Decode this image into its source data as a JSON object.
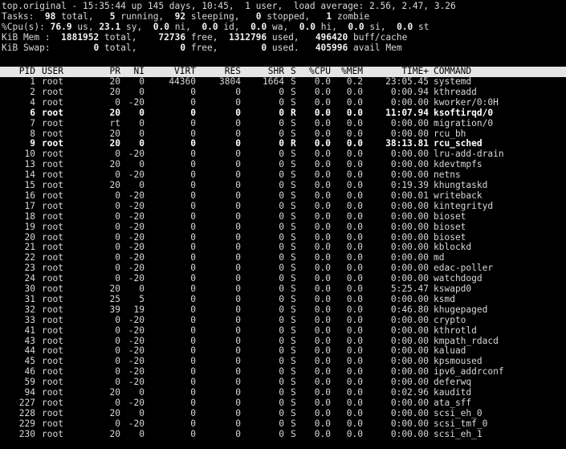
{
  "header": {
    "line1": "top.original - 15:35:44 up 145 days, 10:45,  1 user,  load average: 2.56, 2.47, 3.26",
    "tasks": {
      "label": "Tasks:",
      "total": "98",
      "total_label": "total,",
      "running": "5",
      "running_label": "running,",
      "sleeping": "92",
      "sleeping_label": "sleeping,",
      "stopped": "0",
      "stopped_label": "stopped,",
      "zombie": "1",
      "zombie_label": "zombie"
    },
    "cpu": {
      "label": "%Cpu(s):",
      "us": "76.9",
      "us_label": "us,",
      "sy": "23.1",
      "sy_label": "sy,",
      "ni": "0.0",
      "ni_label": "ni,",
      "id": "0.0",
      "id_label": "id,",
      "wa": "0.0",
      "wa_label": "wa,",
      "hi": "0.0",
      "hi_label": "hi,",
      "si": "0.0",
      "si_label": "si,",
      "st": "0.0",
      "st_label": "st"
    },
    "mem": {
      "label": "KiB Mem :",
      "total": "1881952",
      "total_label": "total,",
      "free": "72736",
      "free_label": "free,",
      "used": "1312796",
      "used_label": "used,",
      "buff": "496420",
      "buff_label": "buff/cache"
    },
    "swap": {
      "label": "KiB Swap:",
      "total": "0",
      "total_label": "total,",
      "free": "0",
      "free_label": "free,",
      "used": "0",
      "used_label": "used.",
      "avail": "405996",
      "avail_label": "avail Mem"
    }
  },
  "columns": {
    "pid": "PID",
    "user": "USER",
    "pr": "PR",
    "ni": "NI",
    "virt": "VIRT",
    "res": "RES",
    "shr": "SHR",
    "s": "S",
    "cpu": "%CPU",
    "mem": "%MEM",
    "time": "TIME+",
    "command": "COMMAND"
  },
  "processes": [
    {
      "pid": "1",
      "user": "root",
      "pr": "20",
      "ni": "0",
      "virt": "44360",
      "res": "3804",
      "shr": "1664",
      "s": "S",
      "cpu": "0.0",
      "mem": "0.2",
      "time": "23:05.45",
      "command": "systemd",
      "running": false
    },
    {
      "pid": "2",
      "user": "root",
      "pr": "20",
      "ni": "0",
      "virt": "0",
      "res": "0",
      "shr": "0",
      "s": "S",
      "cpu": "0.0",
      "mem": "0.0",
      "time": "0:00.94",
      "command": "kthreadd",
      "running": false
    },
    {
      "pid": "4",
      "user": "root",
      "pr": "0",
      "ni": "-20",
      "virt": "0",
      "res": "0",
      "shr": "0",
      "s": "S",
      "cpu": "0.0",
      "mem": "0.0",
      "time": "0:00.00",
      "command": "kworker/0:0H",
      "running": false
    },
    {
      "pid": "6",
      "user": "root",
      "pr": "20",
      "ni": "0",
      "virt": "0",
      "res": "0",
      "shr": "0",
      "s": "R",
      "cpu": "0.0",
      "mem": "0.0",
      "time": "11:07.94",
      "command": "ksoftirqd/0",
      "running": true
    },
    {
      "pid": "7",
      "user": "root",
      "pr": "rt",
      "ni": "0",
      "virt": "0",
      "res": "0",
      "shr": "0",
      "s": "S",
      "cpu": "0.0",
      "mem": "0.0",
      "time": "0:00.00",
      "command": "migration/0",
      "running": false
    },
    {
      "pid": "8",
      "user": "root",
      "pr": "20",
      "ni": "0",
      "virt": "0",
      "res": "0",
      "shr": "0",
      "s": "S",
      "cpu": "0.0",
      "mem": "0.0",
      "time": "0:00.00",
      "command": "rcu_bh",
      "running": false
    },
    {
      "pid": "9",
      "user": "root",
      "pr": "20",
      "ni": "0",
      "virt": "0",
      "res": "0",
      "shr": "0",
      "s": "R",
      "cpu": "0.0",
      "mem": "0.0",
      "time": "38:13.81",
      "command": "rcu_sched",
      "running": true
    },
    {
      "pid": "10",
      "user": "root",
      "pr": "0",
      "ni": "-20",
      "virt": "0",
      "res": "0",
      "shr": "0",
      "s": "S",
      "cpu": "0.0",
      "mem": "0.0",
      "time": "0:00.00",
      "command": "lru-add-drain",
      "running": false
    },
    {
      "pid": "13",
      "user": "root",
      "pr": "20",
      "ni": "0",
      "virt": "0",
      "res": "0",
      "shr": "0",
      "s": "S",
      "cpu": "0.0",
      "mem": "0.0",
      "time": "0:00.00",
      "command": "kdevtmpfs",
      "running": false
    },
    {
      "pid": "14",
      "user": "root",
      "pr": "0",
      "ni": "-20",
      "virt": "0",
      "res": "0",
      "shr": "0",
      "s": "S",
      "cpu": "0.0",
      "mem": "0.0",
      "time": "0:00.00",
      "command": "netns",
      "running": false
    },
    {
      "pid": "15",
      "user": "root",
      "pr": "20",
      "ni": "0",
      "virt": "0",
      "res": "0",
      "shr": "0",
      "s": "S",
      "cpu": "0.0",
      "mem": "0.0",
      "time": "0:19.39",
      "command": "khungtaskd",
      "running": false
    },
    {
      "pid": "16",
      "user": "root",
      "pr": "0",
      "ni": "-20",
      "virt": "0",
      "res": "0",
      "shr": "0",
      "s": "S",
      "cpu": "0.0",
      "mem": "0.0",
      "time": "0:00.01",
      "command": "writeback",
      "running": false
    },
    {
      "pid": "17",
      "user": "root",
      "pr": "0",
      "ni": "-20",
      "virt": "0",
      "res": "0",
      "shr": "0",
      "s": "S",
      "cpu": "0.0",
      "mem": "0.0",
      "time": "0:00.00",
      "command": "kintegrityd",
      "running": false
    },
    {
      "pid": "18",
      "user": "root",
      "pr": "0",
      "ni": "-20",
      "virt": "0",
      "res": "0",
      "shr": "0",
      "s": "S",
      "cpu": "0.0",
      "mem": "0.0",
      "time": "0:00.00",
      "command": "bioset",
      "running": false
    },
    {
      "pid": "19",
      "user": "root",
      "pr": "0",
      "ni": "-20",
      "virt": "0",
      "res": "0",
      "shr": "0",
      "s": "S",
      "cpu": "0.0",
      "mem": "0.0",
      "time": "0:00.00",
      "command": "bioset",
      "running": false
    },
    {
      "pid": "20",
      "user": "root",
      "pr": "0",
      "ni": "-20",
      "virt": "0",
      "res": "0",
      "shr": "0",
      "s": "S",
      "cpu": "0.0",
      "mem": "0.0",
      "time": "0:00.00",
      "command": "bioset",
      "running": false
    },
    {
      "pid": "21",
      "user": "root",
      "pr": "0",
      "ni": "-20",
      "virt": "0",
      "res": "0",
      "shr": "0",
      "s": "S",
      "cpu": "0.0",
      "mem": "0.0",
      "time": "0:00.00",
      "command": "kblockd",
      "running": false
    },
    {
      "pid": "22",
      "user": "root",
      "pr": "0",
      "ni": "-20",
      "virt": "0",
      "res": "0",
      "shr": "0",
      "s": "S",
      "cpu": "0.0",
      "mem": "0.0",
      "time": "0:00.00",
      "command": "md",
      "running": false
    },
    {
      "pid": "23",
      "user": "root",
      "pr": "0",
      "ni": "-20",
      "virt": "0",
      "res": "0",
      "shr": "0",
      "s": "S",
      "cpu": "0.0",
      "mem": "0.0",
      "time": "0:00.00",
      "command": "edac-poller",
      "running": false
    },
    {
      "pid": "24",
      "user": "root",
      "pr": "0",
      "ni": "-20",
      "virt": "0",
      "res": "0",
      "shr": "0",
      "s": "S",
      "cpu": "0.0",
      "mem": "0.0",
      "time": "0:00.00",
      "command": "watchdogd",
      "running": false
    },
    {
      "pid": "30",
      "user": "root",
      "pr": "20",
      "ni": "0",
      "virt": "0",
      "res": "0",
      "shr": "0",
      "s": "S",
      "cpu": "0.0",
      "mem": "0.0",
      "time": "5:25.47",
      "command": "kswapd0",
      "running": false
    },
    {
      "pid": "31",
      "user": "root",
      "pr": "25",
      "ni": "5",
      "virt": "0",
      "res": "0",
      "shr": "0",
      "s": "S",
      "cpu": "0.0",
      "mem": "0.0",
      "time": "0:00.00",
      "command": "ksmd",
      "running": false
    },
    {
      "pid": "32",
      "user": "root",
      "pr": "39",
      "ni": "19",
      "virt": "0",
      "res": "0",
      "shr": "0",
      "s": "S",
      "cpu": "0.0",
      "mem": "0.0",
      "time": "0:46.80",
      "command": "khugepaged",
      "running": false
    },
    {
      "pid": "33",
      "user": "root",
      "pr": "0",
      "ni": "-20",
      "virt": "0",
      "res": "0",
      "shr": "0",
      "s": "S",
      "cpu": "0.0",
      "mem": "0.0",
      "time": "0:00.00",
      "command": "crypto",
      "running": false
    },
    {
      "pid": "41",
      "user": "root",
      "pr": "0",
      "ni": "-20",
      "virt": "0",
      "res": "0",
      "shr": "0",
      "s": "S",
      "cpu": "0.0",
      "mem": "0.0",
      "time": "0:00.00",
      "command": "kthrotld",
      "running": false
    },
    {
      "pid": "43",
      "user": "root",
      "pr": "0",
      "ni": "-20",
      "virt": "0",
      "res": "0",
      "shr": "0",
      "s": "S",
      "cpu": "0.0",
      "mem": "0.0",
      "time": "0:00.00",
      "command": "kmpath_rdacd",
      "running": false
    },
    {
      "pid": "44",
      "user": "root",
      "pr": "0",
      "ni": "-20",
      "virt": "0",
      "res": "0",
      "shr": "0",
      "s": "S",
      "cpu": "0.0",
      "mem": "0.0",
      "time": "0:00.00",
      "command": "kaluad",
      "running": false
    },
    {
      "pid": "45",
      "user": "root",
      "pr": "0",
      "ni": "-20",
      "virt": "0",
      "res": "0",
      "shr": "0",
      "s": "S",
      "cpu": "0.0",
      "mem": "0.0",
      "time": "0:00.00",
      "command": "kpsmoused",
      "running": false
    },
    {
      "pid": "46",
      "user": "root",
      "pr": "0",
      "ni": "-20",
      "virt": "0",
      "res": "0",
      "shr": "0",
      "s": "S",
      "cpu": "0.0",
      "mem": "0.0",
      "time": "0:00.00",
      "command": "ipv6_addrconf",
      "running": false
    },
    {
      "pid": "59",
      "user": "root",
      "pr": "0",
      "ni": "-20",
      "virt": "0",
      "res": "0",
      "shr": "0",
      "s": "S",
      "cpu": "0.0",
      "mem": "0.0",
      "time": "0:00.00",
      "command": "deferwq",
      "running": false
    },
    {
      "pid": "94",
      "user": "root",
      "pr": "20",
      "ni": "0",
      "virt": "0",
      "res": "0",
      "shr": "0",
      "s": "S",
      "cpu": "0.0",
      "mem": "0.0",
      "time": "0:02.96",
      "command": "kauditd",
      "running": false
    },
    {
      "pid": "227",
      "user": "root",
      "pr": "0",
      "ni": "-20",
      "virt": "0",
      "res": "0",
      "shr": "0",
      "s": "S",
      "cpu": "0.0",
      "mem": "0.0",
      "time": "0:00.00",
      "command": "ata_sff",
      "running": false
    },
    {
      "pid": "228",
      "user": "root",
      "pr": "20",
      "ni": "0",
      "virt": "0",
      "res": "0",
      "shr": "0",
      "s": "S",
      "cpu": "0.0",
      "mem": "0.0",
      "time": "0:00.00",
      "command": "scsi_eh_0",
      "running": false
    },
    {
      "pid": "229",
      "user": "root",
      "pr": "0",
      "ni": "-20",
      "virt": "0",
      "res": "0",
      "shr": "0",
      "s": "S",
      "cpu": "0.0",
      "mem": "0.0",
      "time": "0:00.00",
      "command": "scsi_tmf_0",
      "running": false
    },
    {
      "pid": "230",
      "user": "root",
      "pr": "20",
      "ni": "0",
      "virt": "0",
      "res": "0",
      "shr": "0",
      "s": "S",
      "cpu": "0.0",
      "mem": "0.0",
      "time": "0:00.00",
      "command": "scsi_eh_1",
      "running": false
    }
  ],
  "colors": {
    "background": "#000000",
    "foreground": "#d8d8d8",
    "header_bar_bg": "#e5e5e5",
    "header_bar_fg": "#000000",
    "bold": "#ffffff"
  }
}
